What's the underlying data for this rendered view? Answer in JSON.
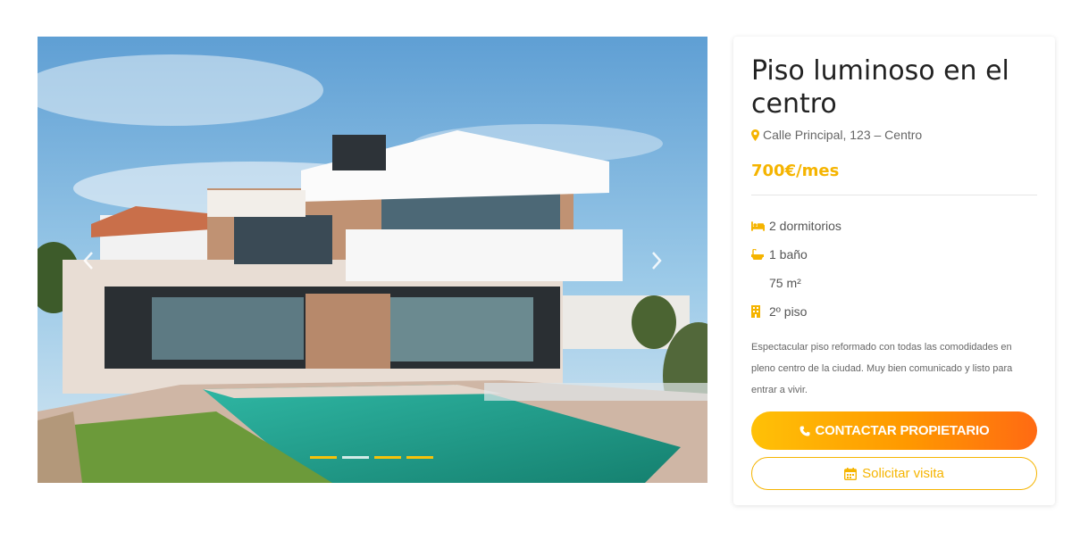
{
  "listing": {
    "title": "Piso luminoso en el centro",
    "address": "Calle Principal, 123 – Centro",
    "price": "700€/mes",
    "features": {
      "bedrooms": "2 dormitorios",
      "bathrooms": "1 baño",
      "area": "75 m²",
      "floor": "2º piso"
    },
    "description": "Espectacular piso reformado con todas las comodidades en pleno centro de la ciudad. Muy bien comunicado y listo para entrar a vivir."
  },
  "actions": {
    "contact_label": "CONTACTAR PROPIETARIO",
    "visit_label": "Solicitar visita"
  },
  "carousel": {
    "slide_count": 4,
    "active_slide": 1,
    "image": "modern-villa-with-pool"
  },
  "icons": {
    "address": "map-marker-icon",
    "bedrooms": "bed-icon",
    "bathrooms": "bath-icon",
    "floor": "building-icon",
    "contact": "phone-icon",
    "visit": "calendar-icon"
  },
  "colors": {
    "accent": "#f5b400",
    "gradient_start": "#ffc107",
    "gradient_end": "#ff6a13",
    "title": "#222222",
    "muted": "#666666"
  }
}
